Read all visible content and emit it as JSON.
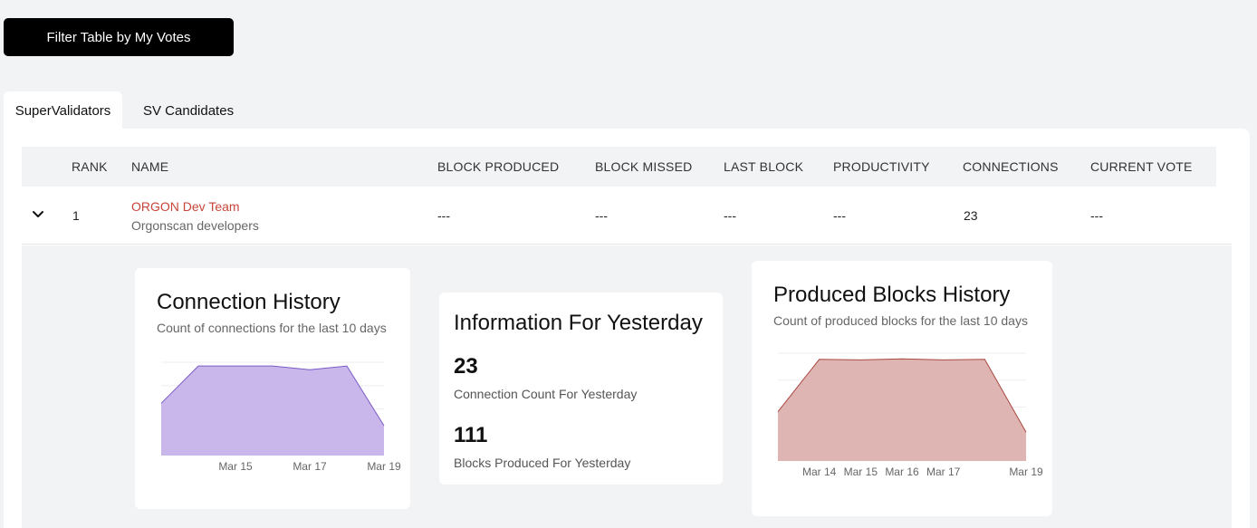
{
  "filter_button": {
    "label": "Filter Table by My Votes"
  },
  "tabs": [
    {
      "label": "SuperValidators",
      "active": true
    },
    {
      "label": "SV Candidates",
      "active": false
    }
  ],
  "table": {
    "headers": [
      "RANK",
      "NAME",
      "BLOCK PRODUCED",
      "BLOCK MISSED",
      "LAST BLOCK",
      "PRODUCTIVITY",
      "CONNECTIONS",
      "CURRENT VOTE"
    ],
    "rows": [
      {
        "rank": "1",
        "name": "ORGON Dev Team",
        "description": "Orgonscan developers",
        "block_produced": "---",
        "block_missed": "---",
        "last_block": "---",
        "productivity": "---",
        "connections": "23",
        "current_vote": "---"
      }
    ]
  },
  "detail": {
    "connection_history": {
      "title": "Connection History",
      "subtitle": "Count of connections for the last 10 days"
    },
    "info_yesterday": {
      "title": "Information For Yesterday",
      "connection_count": "23",
      "connection_label": "Connection Count For Yesterday",
      "blocks_produced": "111",
      "blocks_label": "Blocks Produced For Yesterday"
    },
    "produced_blocks_history": {
      "title": "Produced Blocks History",
      "subtitle": "Count of produced blocks for the last 10 days"
    }
  },
  "colors": {
    "connection_fill": "#c9b6ea",
    "connection_stroke": "#7a5bc4",
    "blocks_fill": "#dfb5b3",
    "blocks_stroke": "#a84840",
    "accent_name": "#c8453a"
  },
  "chart_data": [
    {
      "type": "area",
      "x": [
        "Mar 13",
        "Mar 14",
        "Mar 15",
        "Mar 16",
        "Mar 17",
        "Mar 18",
        "Mar 19"
      ],
      "values": [
        14,
        24,
        24,
        24,
        23,
        24,
        8
      ],
      "tick_labels": [
        "Mar 15",
        "Mar 17",
        "Mar 19"
      ],
      "ylim": [
        0,
        25
      ],
      "grid": true
    },
    {
      "type": "area",
      "x": [
        "Mar 13",
        "Mar 14",
        "Mar 15",
        "Mar 16",
        "Mar 17",
        "Mar 18",
        "Mar 19"
      ],
      "values": [
        480,
        990,
        985,
        995,
        985,
        990,
        280
      ],
      "tick_labels": [
        "Mar 14",
        "Mar 15",
        "Mar 16",
        "Mar 17",
        "Mar 19"
      ],
      "ylim": [
        0,
        1050
      ],
      "grid": true
    }
  ]
}
